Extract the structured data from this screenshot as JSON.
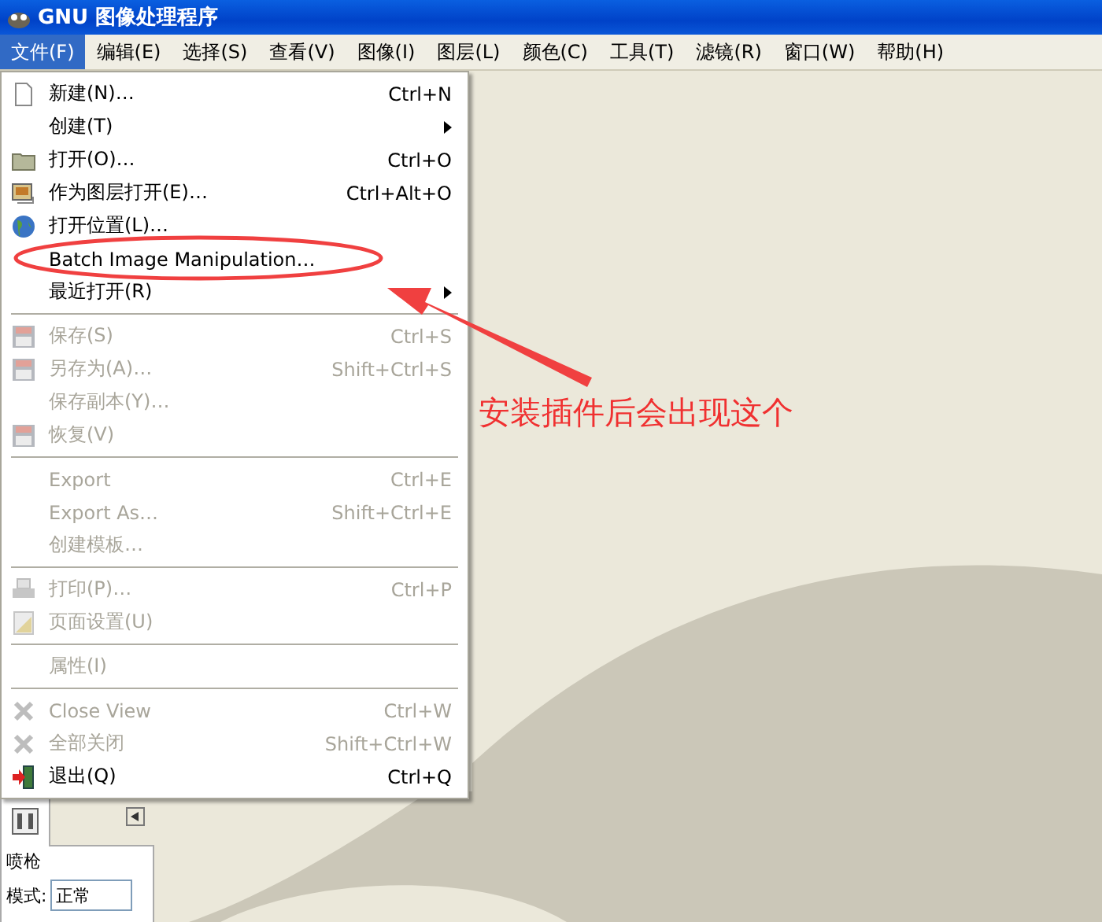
{
  "window": {
    "title": "GNU 图像处理程序"
  },
  "menubar": [
    {
      "label": "文件(F)",
      "selected": true
    },
    {
      "label": "编辑(E)",
      "selected": false
    },
    {
      "label": "选择(S)",
      "selected": false
    },
    {
      "label": "查看(V)",
      "selected": false
    },
    {
      "label": "图像(I)",
      "selected": false
    },
    {
      "label": "图层(L)",
      "selected": false
    },
    {
      "label": "颜色(C)",
      "selected": false
    },
    {
      "label": "工具(T)",
      "selected": false
    },
    {
      "label": "滤镜(R)",
      "selected": false
    },
    {
      "label": "窗口(W)",
      "selected": false
    },
    {
      "label": "帮助(H)",
      "selected": false
    }
  ],
  "file_menu": [
    {
      "kind": "item",
      "label": "新建(N)…",
      "shortcut": "Ctrl+N",
      "disabled": false,
      "submenu": false
    },
    {
      "kind": "item",
      "label": "创建(T)",
      "disabled": false,
      "submenu": true
    },
    {
      "kind": "item",
      "label": "打开(O)…",
      "shortcut": "Ctrl+O",
      "disabled": false,
      "submenu": false
    },
    {
      "kind": "item",
      "label": "作为图层打开(E)…",
      "shortcut": "Ctrl+Alt+O",
      "disabled": false,
      "submenu": false
    },
    {
      "kind": "item",
      "label": "打开位置(L)…",
      "disabled": false,
      "submenu": false
    },
    {
      "kind": "item",
      "label": "Batch Image Manipulation…",
      "disabled": false,
      "submenu": false
    },
    {
      "kind": "item",
      "label": "最近打开(R)",
      "disabled": false,
      "submenu": true
    },
    {
      "kind": "separator"
    },
    {
      "kind": "item",
      "label": "保存(S)",
      "shortcut": "Ctrl+S",
      "disabled": true,
      "submenu": false
    },
    {
      "kind": "item",
      "label": "另存为(A)…",
      "shortcut": "Shift+Ctrl+S",
      "disabled": true,
      "submenu": false
    },
    {
      "kind": "item",
      "label": "保存副本(Y)…",
      "disabled": true,
      "submenu": false
    },
    {
      "kind": "item",
      "label": "恢复(V)",
      "disabled": true,
      "submenu": false
    },
    {
      "kind": "separator"
    },
    {
      "kind": "item",
      "label": "Export",
      "shortcut": "Ctrl+E",
      "disabled": true,
      "submenu": false
    },
    {
      "kind": "item",
      "label": "Export As…",
      "shortcut": "Shift+Ctrl+E",
      "disabled": true,
      "submenu": false
    },
    {
      "kind": "item",
      "label": "创建模板…",
      "disabled": true,
      "submenu": false
    },
    {
      "kind": "separator"
    },
    {
      "kind": "item",
      "label": "打印(P)…",
      "shortcut": "Ctrl+P",
      "disabled": true,
      "submenu": false
    },
    {
      "kind": "item",
      "label": "页面设置(U)",
      "disabled": true,
      "submenu": false
    },
    {
      "kind": "separator"
    },
    {
      "kind": "item",
      "label": "属性(I)",
      "disabled": true,
      "submenu": false
    },
    {
      "kind": "separator"
    },
    {
      "kind": "item",
      "label": "Close View",
      "shortcut": "Ctrl+W",
      "disabled": true,
      "submenu": false
    },
    {
      "kind": "item",
      "label": "全部关闭",
      "shortcut": "Shift+Ctrl+W",
      "disabled": true,
      "submenu": false
    },
    {
      "kind": "item",
      "label": "退出(Q)",
      "shortcut": "Ctrl+Q",
      "disabled": false,
      "submenu": false
    }
  ],
  "tool_options": {
    "tool": "喷枪",
    "mode_label": "模式:",
    "mode_value": "正常"
  },
  "annotation": {
    "text": "安装插件后会出现这个"
  }
}
